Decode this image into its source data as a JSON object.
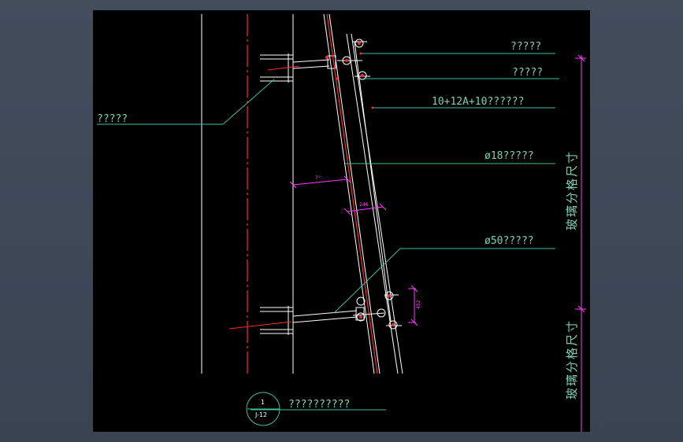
{
  "labels": {
    "top_right_1": "?????",
    "top_right_2": "?????",
    "glass": "10+12A+10??????",
    "rod18": "ø18?????",
    "rod50": "ø50?????",
    "left_note": "?????",
    "dim_vertical_upper": "玻璃分格尺寸",
    "dim_vertical_lower": "玻璃分格尺寸",
    "angle": "7°",
    "dim_246": "246",
    "dim_452": "452",
    "detail_title": "??????????",
    "detail_num": "1",
    "detail_sheet": "J-12"
  },
  "colors": {
    "leader": "#3fbf9f",
    "red": "#ff2a2a",
    "magenta": "#ff3cff",
    "white": "#ffffff",
    "text": "#7fd1b3"
  }
}
